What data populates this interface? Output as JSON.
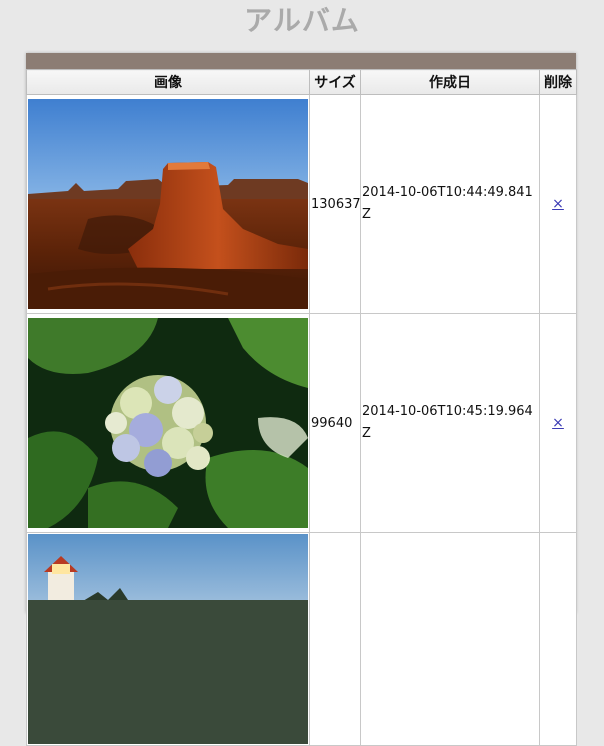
{
  "page": {
    "title": "アルバム"
  },
  "table": {
    "headers": {
      "image": "画像",
      "size": "サイズ",
      "created": "作成日",
      "delete": "削除"
    },
    "rows": [
      {
        "size": "130637",
        "created": "2014-10-06T10:44:49.841Z",
        "delete_label": "×"
      },
      {
        "size": "99640",
        "created": "2014-10-06T10:45:19.964Z",
        "delete_label": "×"
      }
    ]
  },
  "colors": {
    "panel_bar": "#8c7d74",
    "background": "#e8e8e8",
    "link": "#3b3bb5"
  }
}
